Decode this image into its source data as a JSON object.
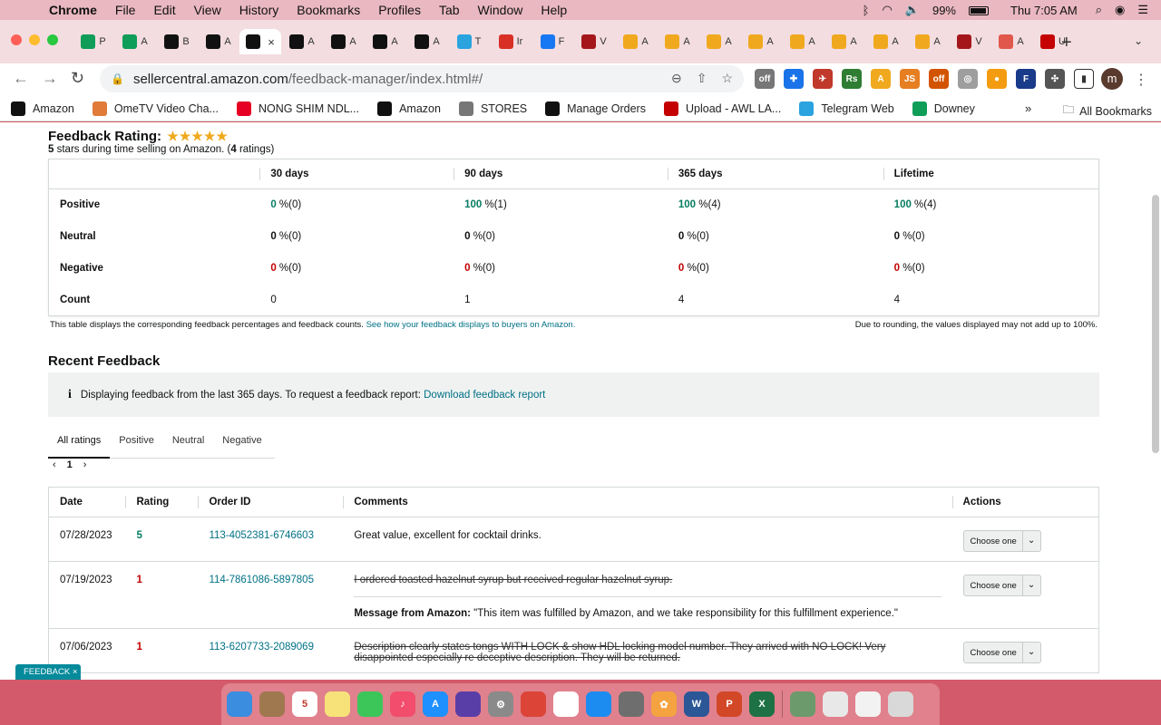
{
  "menubar": {
    "items": [
      "Chrome",
      "File",
      "Edit",
      "View",
      "History",
      "Bookmarks",
      "Profiles",
      "Tab",
      "Window",
      "Help"
    ],
    "battery": "99%",
    "clock": "Thu 7:05 AM"
  },
  "tabs": [
    {
      "letter": "P",
      "icon": "sheets-icon",
      "color": "#0f9d58"
    },
    {
      "letter": "A",
      "icon": "sheets-icon",
      "color": "#0f9d58"
    },
    {
      "letter": "B",
      "icon": "amazon-icon",
      "color": "#111111"
    },
    {
      "letter": "A",
      "icon": "amazon-icon",
      "color": "#111111"
    },
    {
      "letter": "",
      "icon": "amazon-icon",
      "color": "#111111",
      "active": true
    },
    {
      "letter": "A",
      "icon": "amazon-icon",
      "color": "#111111"
    },
    {
      "letter": "A",
      "icon": "amazon-icon",
      "color": "#111111"
    },
    {
      "letter": "A",
      "icon": "amazon-icon",
      "color": "#111111"
    },
    {
      "letter": "A",
      "icon": "amazon-icon",
      "color": "#111111"
    },
    {
      "letter": "T",
      "icon": "telegram-icon",
      "color": "#2aa3df"
    },
    {
      "letter": "Ir",
      "icon": "gmail-icon",
      "color": "#d93025"
    },
    {
      "letter": "F",
      "icon": "facebook-icon",
      "color": "#1877f2"
    },
    {
      "letter": "V",
      "icon": "vw-icon",
      "color": "#a4161a"
    },
    {
      "letter": "A",
      "icon": "amazon-icon",
      "color": "#f0a91e"
    },
    {
      "letter": "A",
      "icon": "amazon-icon",
      "color": "#f0a91e"
    },
    {
      "letter": "A",
      "icon": "amazon-icon",
      "color": "#f0a91e"
    },
    {
      "letter": "A",
      "icon": "amazon-icon",
      "color": "#f0a91e"
    },
    {
      "letter": "A",
      "icon": "amazon-icon",
      "color": "#f0a91e"
    },
    {
      "letter": "A",
      "icon": "amazon-icon",
      "color": "#f0a91e"
    },
    {
      "letter": "A",
      "icon": "amazon-icon",
      "color": "#f0a91e"
    },
    {
      "letter": "A",
      "icon": "amazon-icon",
      "color": "#f0a91e"
    },
    {
      "letter": "V",
      "icon": "vw-icon",
      "color": "#a4161a"
    },
    {
      "letter": "A",
      "icon": "ext-icon",
      "color": "#e2574c"
    },
    {
      "letter": "U",
      "icon": "upload-icon",
      "color": "#c40000"
    }
  ],
  "address": {
    "host": "sellercentral.amazon.com",
    "path": "/feedback-manager/index.html#/"
  },
  "bookmarks": [
    {
      "label": "Amazon",
      "icon": "amazon-icon",
      "color": "#111111"
    },
    {
      "label": "OmeTV Video Cha...",
      "icon": "ometv-icon",
      "color": "#e07b39"
    },
    {
      "label": "NONG SHIM NDL...",
      "icon": "pinterest-icon",
      "color": "#e60023"
    },
    {
      "label": "Amazon",
      "icon": "amazon-icon",
      "color": "#111111"
    },
    {
      "label": "STORES",
      "icon": "folder-icon",
      "color": "#777777"
    },
    {
      "label": "Manage Orders",
      "icon": "amazon-icon",
      "color": "#111111"
    },
    {
      "label": "Upload - AWL LA...",
      "icon": "upload-icon",
      "color": "#c40000"
    },
    {
      "label": "Telegram Web",
      "icon": "telegram-icon",
      "color": "#2aa3df"
    },
    {
      "label": "Downey",
      "icon": "sheets-icon",
      "color": "#0f9d58"
    }
  ],
  "all_bookmarks": "All Bookmarks",
  "rating": {
    "title": "Feedback Rating:",
    "stars": "★★★★★",
    "sub_stars": "5",
    "sub_text1": " stars during time selling on Amazon. (",
    "sub_count": "4",
    "sub_text2": " ratings)"
  },
  "summary": {
    "columns": [
      "",
      "30 days",
      "90 days",
      "365 days",
      "Lifetime"
    ],
    "rows": [
      {
        "label": "Positive",
        "cells": [
          {
            "num": "0",
            "rest": " %(0)",
            "tone": "green"
          },
          {
            "num": "100",
            "rest": " %(1)",
            "tone": "green"
          },
          {
            "num": "100",
            "rest": " %(4)",
            "tone": "green"
          },
          {
            "num": "100",
            "rest": " %(4)",
            "tone": "green"
          }
        ]
      },
      {
        "label": "Neutral",
        "cells": [
          {
            "num": "0",
            "rest": " %(0)",
            "tone": "plain"
          },
          {
            "num": "0",
            "rest": " %(0)",
            "tone": "plain"
          },
          {
            "num": "0",
            "rest": " %(0)",
            "tone": "plain"
          },
          {
            "num": "0",
            "rest": " %(0)",
            "tone": "plain"
          }
        ]
      },
      {
        "label": "Negative",
        "cells": [
          {
            "num": "0",
            "rest": " %(0)",
            "tone": "red"
          },
          {
            "num": "0",
            "rest": " %(0)",
            "tone": "red"
          },
          {
            "num": "0",
            "rest": " %(0)",
            "tone": "red"
          },
          {
            "num": "0",
            "rest": " %(0)",
            "tone": "red"
          }
        ]
      },
      {
        "label": "Count",
        "cells": [
          {
            "num": "0",
            "rest": "",
            "tone": "count"
          },
          {
            "num": "1",
            "rest": "",
            "tone": "count"
          },
          {
            "num": "4",
            "rest": "",
            "tone": "count"
          },
          {
            "num": "4",
            "rest": "",
            "tone": "count"
          }
        ]
      }
    ],
    "note": "This table displays the corresponding feedback percentages and feedback counts.",
    "note_link": "See how your feedback displays to buyers on Amazon.",
    "rounding": "Due to rounding, the values displayed may not add up to 100%."
  },
  "recent": {
    "title": "Recent Feedback",
    "info": "Displaying feedback from the last 365 days. To request a feedback report:",
    "info_link": "Download feedback report",
    "filters": [
      "All ratings",
      "Positive",
      "Neutral",
      "Negative"
    ],
    "page": "1",
    "columns": [
      "Date",
      "Rating",
      "Order ID",
      "Comments",
      "Actions"
    ],
    "rows": [
      {
        "date": "07/28/2023",
        "rating": "5",
        "tone": "green",
        "order": "113-4052381-6746603",
        "comment": "Great value, excellent for cocktail drinks.",
        "struck": false,
        "msg_label": "",
        "msg": ""
      },
      {
        "date": "07/19/2023",
        "rating": "1",
        "tone": "red",
        "order": "114-7861086-5897805",
        "comment": "I ordered toasted hazelnut syrup but received regular hazelnut syrup.",
        "struck": true,
        "msg_label": "Message from Amazon:",
        "msg": "\"This item was fulfilled by Amazon, and we take responsibility for this fulfillment experience.\""
      },
      {
        "date": "07/06/2023",
        "rating": "1",
        "tone": "red",
        "order": "113-6207733-2089069",
        "comment": "Description clearly states tongs WITH LOCK & show HDL locking model number. They arrived with NO LOCK! Very disappointed especially re deceptive description. They will be returned.",
        "struck": true,
        "msg_label": "",
        "msg": ""
      }
    ],
    "action_label": "Choose one"
  },
  "feedback_pill": "FEEDBACK ×",
  "dock": [
    {
      "name": "finder-icon",
      "color": "#3b8de0",
      "glyph": ""
    },
    {
      "name": "notes-brown-icon",
      "color": "#a07850",
      "glyph": ""
    },
    {
      "name": "calendar-icon",
      "color": "#ffffff",
      "glyph": "5"
    },
    {
      "name": "notes-icon",
      "color": "#f7e27a",
      "glyph": ""
    },
    {
      "name": "facetime-icon",
      "color": "#3cc65a",
      "glyph": ""
    },
    {
      "name": "music-icon",
      "color": "#f24d6d",
      "glyph": "♪"
    },
    {
      "name": "appstore-icon",
      "color": "#1e90ff",
      "glyph": "A"
    },
    {
      "name": "siri-icon",
      "color": "#5a3ea8",
      "glyph": ""
    },
    {
      "name": "settings-icon",
      "color": "#8a8a8a",
      "glyph": "⚙"
    },
    {
      "name": "chrome-icon",
      "color": "#db4437",
      "glyph": ""
    },
    {
      "name": "reminders-icon",
      "color": "#ffffff",
      "glyph": ""
    },
    {
      "name": "safari-icon",
      "color": "#1c8cf0",
      "glyph": ""
    },
    {
      "name": "launchpad-icon",
      "color": "#6e6e6e",
      "glyph": ""
    },
    {
      "name": "photos-icon",
      "color": "#f4a340",
      "glyph": "✿"
    },
    {
      "name": "word-icon",
      "color": "#2b5797",
      "glyph": "W"
    },
    {
      "name": "powerpoint-icon",
      "color": "#d24726",
      "glyph": "P"
    },
    {
      "name": "excel-icon",
      "color": "#1e7145",
      "glyph": "X"
    },
    {
      "name": "preview-icon",
      "color": "#6c9a6c",
      "glyph": ""
    },
    {
      "name": "window-icon",
      "color": "#e8e8e8",
      "glyph": ""
    },
    {
      "name": "document-icon",
      "color": "#f2f2f2",
      "glyph": ""
    },
    {
      "name": "trash-icon",
      "color": "#d9d9d9",
      "glyph": ""
    }
  ]
}
